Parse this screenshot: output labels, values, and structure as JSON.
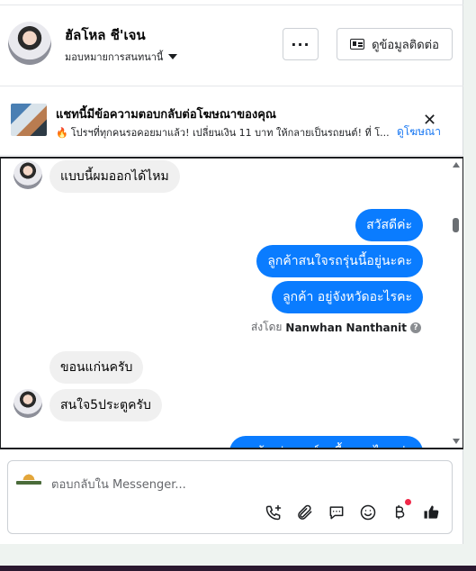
{
  "header": {
    "contact_name": "ฮัลโหล ชี'เจน",
    "assign_label": "มอบหมายการสนทนานี้",
    "more_label": "···",
    "contact_info_label": "ดูข้อมูลติดต่อ"
  },
  "ad": {
    "title": "แชทนี้มีข้อความตอบกลับต่อโฆษณาของคุณ",
    "description": "โปรฯที่ทุกคนรอคอยมาแล้ว! เปลี่ยนเงิน 11 บาท ให้กลายเป็นรถยนต์! ที่ โ...",
    "link_label": "ดูโฆษณา",
    "close_label": "✕"
  },
  "messages": [
    {
      "side": "in",
      "text": "แบบนี้ผมออกได้ไหม"
    },
    {
      "side": "out",
      "text": "สวัสดีค่ะ"
    },
    {
      "side": "out",
      "text": "ลูกค้าสนใจรถรุ่นนี้อยู่นะคะ"
    },
    {
      "side": "out",
      "text": "ลูกค้า  อยู่จังหวัดอะไรคะ"
    },
    {
      "side": "in",
      "text": "ขอนแก่นครับ"
    },
    {
      "side": "in",
      "text": "สนใจ5ประตูครับ"
    },
    {
      "side": "out",
      "text": "ลูกค้า ประสงค์จะซื้อแบบไหนค่ะ"
    }
  ],
  "sent_by": {
    "prefix": "ส่งโดย",
    "name": "Nanwhan Nanthanit",
    "help": "?"
  },
  "composer": {
    "placeholder": "ตอบกลับใน Messenger..."
  },
  "icons": [
    "id-card-icon",
    "phone-plus-icon",
    "attachment-icon",
    "chat-icon",
    "emoji-icon",
    "baht-icon",
    "like-icon"
  ],
  "colors": {
    "outgoing": "#0a7cff",
    "incoming": "#f0f0f0",
    "link": "#1877f2",
    "badge": "#f02849"
  }
}
